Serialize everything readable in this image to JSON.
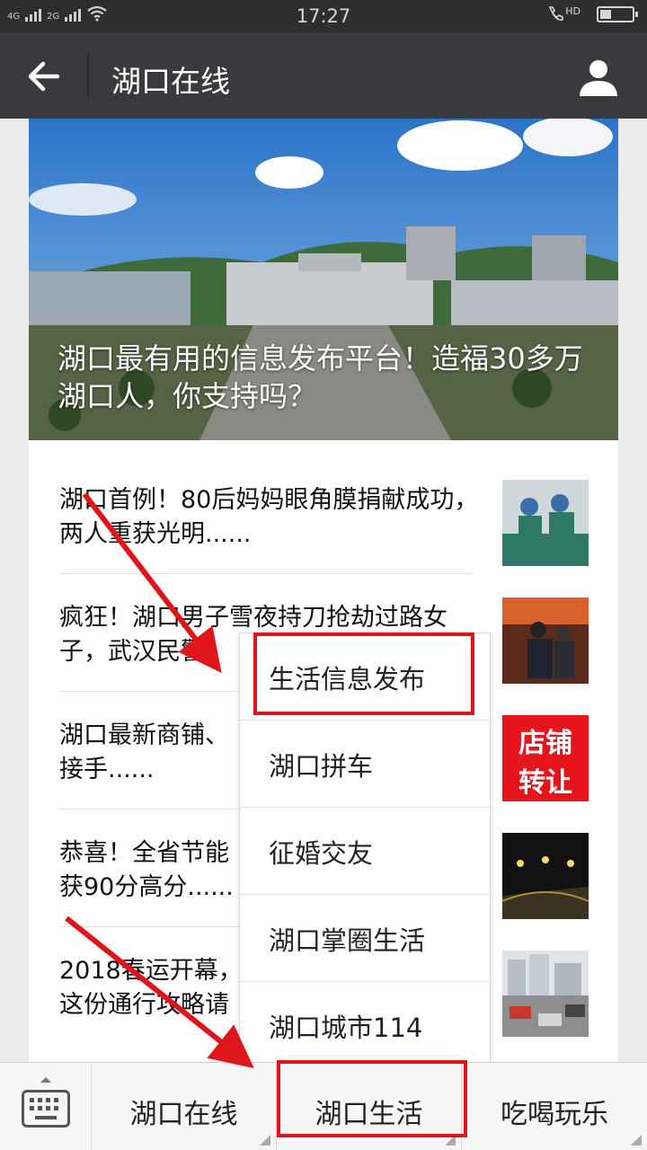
{
  "status_bar": {
    "net1": "4G",
    "net2": "2G",
    "time": "17:27",
    "hd": "HD"
  },
  "header": {
    "title": "湖口在线"
  },
  "hero": {
    "title": "湖口最有用的信息发布平台！造福30多万湖口人，你支持吗？"
  },
  "articles": [
    {
      "title": "湖口首例！80后妈妈眼角膜捐献成功，两人重获光明......"
    },
    {
      "title": "疯狂！湖口男子雪夜持刀抢劫过路女子，武汉民警"
    },
    {
      "title": "湖口最新商铺、",
      "title2": "接手......",
      "thumb_text1": "店铺",
      "thumb_text2": "转让"
    },
    {
      "title": "恭喜！全省节能",
      "title2": "获90分高分......"
    },
    {
      "title": "2018春运开幕，",
      "title2": "这份通行攻略请"
    }
  ],
  "popup_menu": {
    "items": [
      "生活信息发布",
      "湖口拼车",
      "征婚交友",
      "湖口掌圈生活",
      "湖口城市114"
    ]
  },
  "bottom_menu": {
    "tabs": [
      "湖口在线",
      "湖口生活",
      "吃喝玩乐"
    ]
  },
  "colors": {
    "status_bar": "#2e2e2e",
    "title_bar": "#393a3e",
    "annotation_red": "#e0151b"
  }
}
